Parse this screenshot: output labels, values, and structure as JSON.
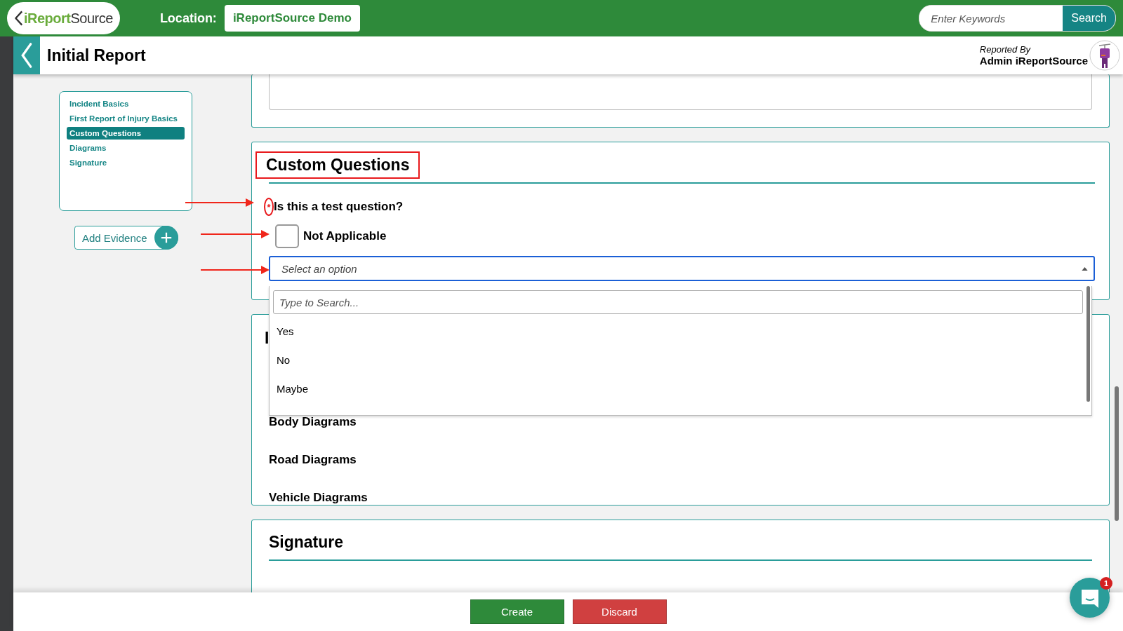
{
  "top_bar": {
    "logo": {
      "lead": "iReport",
      "rest": "Source"
    },
    "location_label": "Location:",
    "location": "iReportSource Demo",
    "search": {
      "placeholder": "Enter Keywords",
      "button": "Search"
    }
  },
  "header": {
    "title": "Initial Report",
    "reported_by_label": "Reported By",
    "reported_by": "Admin iReportSource"
  },
  "sidebar": {
    "items": [
      {
        "label": "Incident Basics",
        "selected": false
      },
      {
        "label": "First Report of Injury Basics",
        "selected": false
      },
      {
        "label": "Custom Questions",
        "selected": true
      },
      {
        "label": "Diagrams",
        "selected": false
      },
      {
        "label": "Signature",
        "selected": false
      }
    ],
    "add_evidence": "Add Evidence"
  },
  "custom_questions": {
    "title": "Custom Questions",
    "question": {
      "required_mark": "*",
      "text": "Is this a test question?"
    },
    "not_applicable": {
      "label": "Not Applicable",
      "checked": false
    },
    "select": {
      "placeholder": "Select an option",
      "expanded": true,
      "search_placeholder": "Type to Search...",
      "options": [
        "Yes",
        "No",
        "Maybe"
      ]
    }
  },
  "diagrams": {
    "title_visible": "I",
    "items": [
      "Body Diagrams",
      "Road Diagrams",
      "Vehicle Diagrams"
    ]
  },
  "signature": {
    "title": "Signature"
  },
  "footer": {
    "buttons": [
      {
        "label": "Create",
        "kind": "primary"
      },
      {
        "label": "Discard",
        "kind": "danger"
      }
    ]
  },
  "chat": {
    "badge": "1"
  }
}
